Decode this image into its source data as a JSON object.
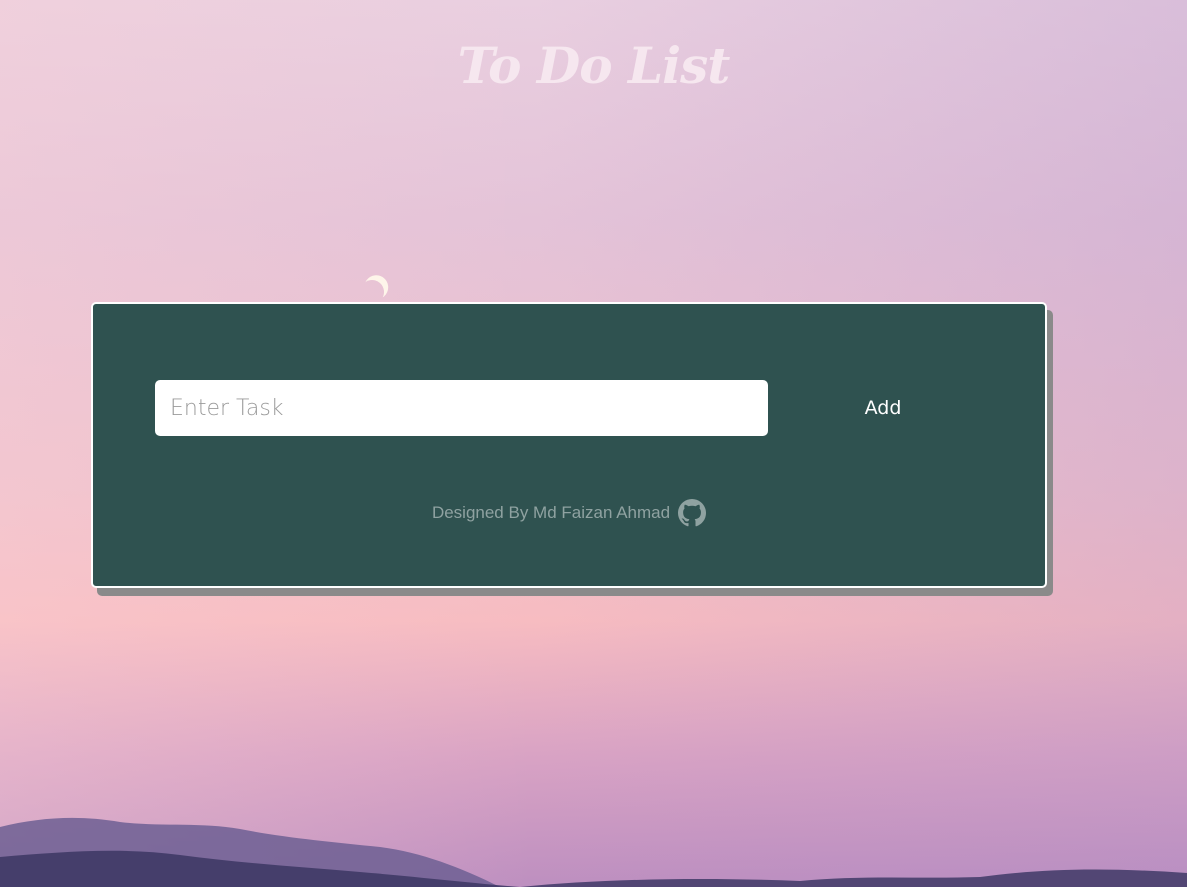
{
  "header": {
    "title": "To Do List"
  },
  "task_form": {
    "input_placeholder": "Enter Task",
    "input_value": "",
    "add_label": "Add"
  },
  "footer": {
    "credit": "Designed By Md Faizan Ahmad",
    "icon": "github-icon"
  },
  "colors": {
    "card_background": "#2f5250",
    "title_color": "#f6e7ef",
    "credit_color": "#8fa2a1"
  }
}
